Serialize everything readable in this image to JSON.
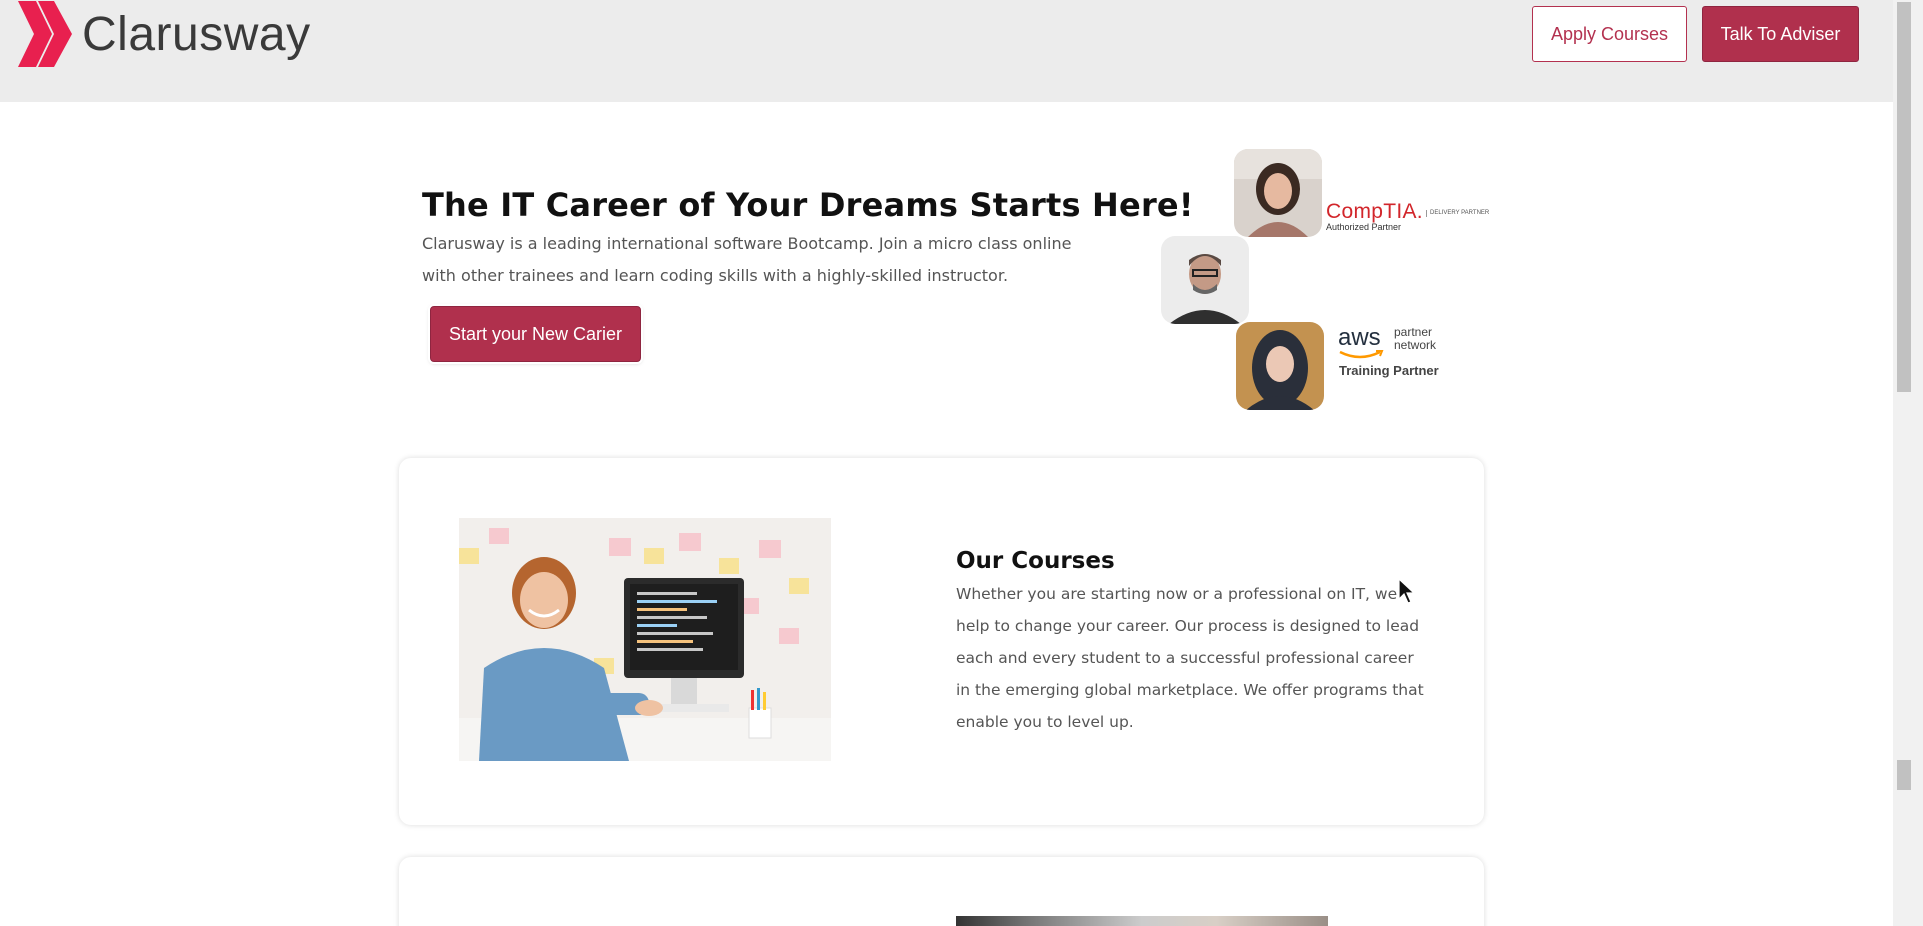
{
  "header": {
    "brand_name": "Clarusway",
    "apply_label": "Apply Courses",
    "adviser_label": "Talk To Adviser",
    "brand_color": "#e8204f"
  },
  "hero": {
    "title": "The IT Career of Your Dreams Starts Here!",
    "description": "Clarusway is a leading international software Bootcamp. Join a micro class online with other trainees and learn coding skills with a highly-skilled instructor.",
    "cta_label": "Start your New Carier",
    "partners": {
      "comptia_name": "CompTIA.",
      "comptia_sub": "Authorized Partner",
      "comptia_tag": "DELIVERY PARTNER",
      "aws_word": "aws",
      "aws_network": "partner network",
      "aws_role": "Training Partner"
    }
  },
  "courses": {
    "title": "Our Courses",
    "description": "Whether you are starting now or a professional on IT, we help to change your career. Our process is designed to lead each and every student to a successful professional career in the emerging global marketplace. We offer programs that enable you to level up."
  },
  "colors": {
    "accent": "#b0304d",
    "header_bg": "#ececec"
  },
  "icons": [
    "clarusway-logo-icon",
    "mouse-cursor-icon"
  ]
}
